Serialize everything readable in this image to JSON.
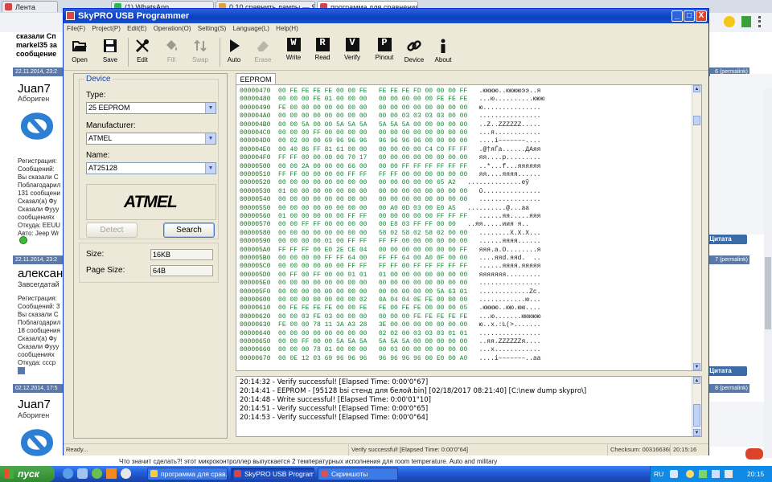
{
  "browser": {
    "tabs": [
      {
        "label": "Лента",
        "color": "#d64545"
      },
      {
        "label": "(1) WhatsApp",
        "color": "#2fb84a"
      },
      {
        "label": "0,10 сравнить дампы — Ян...",
        "color": "#e0a03c"
      },
      {
        "label": "программа для сравнения",
        "color": "#d64545"
      }
    ]
  },
  "forum": {
    "top_lines": [
      "сказали Сп",
      "markel35 за",
      "сообщение"
    ],
    "posts": [
      {
        "date": "22.11.2014, 23:2",
        "right_head": "6 (permalink)",
        "author": "Juan7",
        "rank": "Абориген",
        "info": "Регистрация:\nСообщений:\nВы сказали С\nПоблагодарил\n131 сообщени\nСказал(а) Фу\nСказали Фууу\nсообщениях\nОткуда: EEUU\nАвто: Jeep Wr"
      },
      {
        "date": "22.11.2014, 23:2",
        "right_head": "7 (permalink)",
        "author": "александ",
        "rank": "Завсегдатай",
        "info": "Регистрация:\nСообщений: 3\nВы сказали С\nПоблагодарил\n18 сообщения\nСказал(а) Фу\nСказали Фууу\nсообщениях\nОткуда: ссср"
      },
      {
        "date": "02.12.2014, 17:5",
        "right_head": "8 (permalink)",
        "author": "Juan7",
        "rank": "Абориген",
        "info": ""
      }
    ],
    "quote_label": "Цитата",
    "bottom_text": "Что значит сделать?! этот микроконтроллер выпускается 2 температурных исполнения для room temperature. Auto and military"
  },
  "window": {
    "title": "SkyPRO USB Programmer",
    "controls": {
      "minimize": "_",
      "maximize": "□",
      "close": "X"
    }
  },
  "menu": [
    "File(F)",
    "Project(P)",
    "Edit(E)",
    "Operation(O)",
    "Setting(S)",
    "Language(L)",
    "Help(H)"
  ],
  "toolbar": {
    "open": "Open",
    "save": "Save",
    "edit": "Edit",
    "fill": "Fill",
    "swap": "Swap",
    "auto": "Auto",
    "erase": "Erase",
    "write": "Write",
    "read": "Read",
    "verify": "Verify",
    "pinout": "Pinout",
    "device": "Device",
    "about": "About",
    "write_letter": "W",
    "read_letter": "R",
    "verify_letter": "V",
    "pinout_letter": "P"
  },
  "device": {
    "group_title": "Device",
    "type_label": "Type:",
    "type_value": "25 EEPROM",
    "manufacturer_label": "Manufacturer:",
    "manufacturer_value": "ATMEL",
    "name_label": "Name:",
    "name_value": "AT25128",
    "logo_text": "ATMEL",
    "detect_button": "Detect",
    "search_button": "Search"
  },
  "size": {
    "size_label": "Size:",
    "size_value": "16KB",
    "page_size_label": "Page Size:",
    "page_size_value": "64B"
  },
  "eeprom": {
    "tab_label": "EEPROM",
    "rows": [
      {
        "addr": "00000470",
        "bytes": "00 FE FE FE FE 00 00 FE   FE FE FE FD 00 00 00 FF",
        "ascii": ".юююю..ююююээ..я"
      },
      {
        "addr": "00000480",
        "bytes": "00 00 00 FE 01 00 00 00   00 00 00 00 00 FE FE FE",
        "ascii": "...ю..........ююю"
      },
      {
        "addr": "00000490",
        "bytes": "FE 00 00 00 00 00 00 00   00 00 00 00 00 00 00 00",
        "ascii": "ю..............."
      },
      {
        "addr": "000004A0",
        "bytes": "00 00 00 00 00 00 00 00   00 00 03 03 03 03 00 00",
        "ascii": "................"
      },
      {
        "addr": "000004B0",
        "bytes": "00 00 5A 00 00 5A 5A 5A   5A 5A 5A 00 00 00 00 00",
        "ascii": "..Z..ZZZZZZ....."
      },
      {
        "addr": "000004C0",
        "bytes": "00 00 00 FF 00 00 00 00   00 00 00 00 00 00 00 00",
        "ascii": "...я............"
      },
      {
        "addr": "000004D0",
        "bytes": "00 02 00 00 69 96 96 96   96 96 96 96 00 00 00 00",
        "ascii": "....i–––––––...."
      },
      {
        "addr": "000004E0",
        "bytes": "00 40 86 FF 81 61 00 00   00 00 00 00 C4 C0 FF FF",
        "ascii": ".@†яЃа......ДАяя"
      },
      {
        "addr": "000004F0",
        "bytes": "FF FF 00 00 00 00 70 17   00 00 00 00 00 00 00 00",
        "ascii": "яя....p........."
      },
      {
        "addr": "00000500",
        "bytes": "00 00 2A 00 00 00 66 00   00 00 FF FF FF FF FF FF",
        "ascii": "..*...f...яяяяяя"
      },
      {
        "addr": "00000510",
        "bytes": "FF FF 00 00 00 00 FF FF   FF FF 00 00 00 00 00 00",
        "ascii": "яя....яяяя......"
      },
      {
        "addr": "00000520",
        "bytes": "00 00 00 00 00 00 00 00   00 00 00 00 00 65 A2",
        "ascii": "..............eў"
      },
      {
        "addr": "00000530",
        "bytes": "01 00 00 00 00 00 00 00   00 00 00 00 00 00 00 00",
        "ascii": "ῠ..............."
      },
      {
        "addr": "00000540",
        "bytes": "00 00 00 00 00 00 00 00   00 00 00 00 00 00 00 00",
        "ascii": "................"
      },
      {
        "addr": "00000550",
        "bytes": "00 00 00 00 00 00 00 00   00 A0 0D 03 00 E0 A5",
        "ascii": "..........@...aa"
      },
      {
        "addr": "00000560",
        "bytes": "01 00 00 00 00 00 FF FF   00 00 00 00 00 FF FF FF",
        "ascii": "......яя.....яяя"
      },
      {
        "addr": "00000570",
        "bytes": "00 00 FF FF 00 00 00 00   00 E8 03 FF FF 00 00",
        "ascii": "..яя.....иия я.."
      },
      {
        "addr": "00000580",
        "bytes": "00 00 00 00 00 00 00 00   58 02 58 02 58 02 00 00",
        "ascii": "........X.X.X..."
      },
      {
        "addr": "00000590",
        "bytes": "00 00 00 00 01 00 FF FF   FF FF 00 00 00 00 00 00",
        "ascii": "......яяяя......"
      },
      {
        "addr": "000005A0",
        "bytes": "FF FF FF 00 E0 2E CE 04   00 00 00 00 00 00 00 FF",
        "ascii": "яяя.а.О........я"
      },
      {
        "addr": "000005B0",
        "bytes": "00 00 00 00 FF FF 64 00   FF FF 64 00 A0 0F 00 00",
        "ascii": "....яяd.яяd.  .."
      },
      {
        "addr": "000005C0",
        "bytes": "00 00 00 00 00 00 FF FF   FF FF 00 FF FF FF FF FF",
        "ascii": "......яяяя.яяяяя"
      },
      {
        "addr": "000005D0",
        "bytes": "00 FF 00 FF 00 00 01 01   01 00 00 00 00 00 00 00",
        "ascii": "яяяяяяя........."
      },
      {
        "addr": "000005E0",
        "bytes": "00 00 00 00 00 00 00 00   00 00 00 00 00 00 00 00",
        "ascii": "................"
      },
      {
        "addr": "000005F0",
        "bytes": "00 00 00 00 00 00 00 00   00 00 00 00 00 5A 63 01",
        "ascii": ".............Zc."
      },
      {
        "addr": "00000600",
        "bytes": "00 00 00 00 00 00 00 02   0A 04 04 0E FE 00 00 00",
        "ascii": "............ю..."
      },
      {
        "addr": "00000610",
        "bytes": "00 FE FE FE FE 00 00 FE   FE 00 FE FE 00 00 00 05",
        "ascii": ".юююю..юю.юю...."
      },
      {
        "addr": "00000620",
        "bytes": "00 00 03 FE 03 00 00 00   00 00 00 FE FE FE FE FE",
        "ascii": "...ю.......ююююю"
      },
      {
        "addr": "00000630",
        "bytes": "FE 00 00 78 11 3A A3 28   3E 00 00 00 00 00 00 00",
        "ascii": "ю..x.:Ŀ(>......."
      },
      {
        "addr": "00000640",
        "bytes": "00 00 00 00 00 00 00 00   02 02 00 03 03 03 01 01",
        "ascii": "................"
      },
      {
        "addr": "00000650",
        "bytes": "00 00 FF 00 00 5A 5A 5A   5A 5A 5A 00 00 00 00 00",
        "ascii": "..яя.ZZZZZZя...."
      },
      {
        "addr": "00000660",
        "bytes": "00 00 00 78 01 00 00 00   00 03 00 00 00 00 00 00",
        "ascii": "...x............"
      },
      {
        "addr": "00000670",
        "bytes": "00 0E 12 03 69 96 96 96   96 96 96 96 00 E0 00 A0",
        "ascii": "....i–––––––..aa"
      }
    ]
  },
  "log": [
    "20:14:32  -  Verify successful! [Elapsed Time: 0:00'0\"67]",
    "20:14:41  -  EEPROM - [95128 bsi стенд для белой.bin] [02/18/2017 08:21:40] [C:\\new dump skypro\\]",
    "20:14:48  -  Write successful! [Elapsed Time: 0:00'01\"10]",
    "20:14:51  -  Verify successful! [Elapsed Time: 0:00'0\"65]",
    "20:14:53  -  Verify successful! [Elapsed Time: 0:00'0\"64]"
  ],
  "status": {
    "ready": "Ready...",
    "last": "Verify successful! [Elapsed Time: 0:00'0\"64]",
    "checksum": "Checksum: 00316636H",
    "time": "20:15:16"
  },
  "taskbar": {
    "start": "пуск",
    "tasks": [
      {
        "label": "программа для срав...",
        "color": "#ffcc33"
      },
      {
        "label": "SkyPRO USB Program...",
        "color": "#d64545"
      },
      {
        "label": "Скриншоты",
        "color": "#e05050"
      }
    ],
    "lang": "RU",
    "clock": "20:15"
  }
}
